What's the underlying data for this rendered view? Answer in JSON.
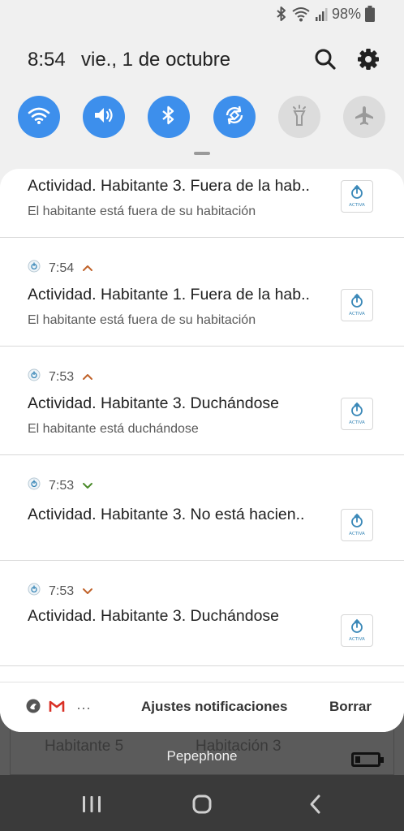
{
  "status_bar": {
    "battery": "98%"
  },
  "header": {
    "time": "8:54",
    "date": "vie., 1 de octubre"
  },
  "quick_settings": [
    {
      "name": "wifi",
      "on": true
    },
    {
      "name": "sound",
      "on": true
    },
    {
      "name": "bluetooth",
      "on": true
    },
    {
      "name": "auto-rotate",
      "on": true
    },
    {
      "name": "flashlight",
      "on": false
    },
    {
      "name": "airplane",
      "on": false
    }
  ],
  "notifications": [
    {
      "title": "Actividad. Habitante 3. Fuera de la hab..",
      "text": "El habitante está fuera de su habitación",
      "time": ""
    },
    {
      "title": "Actividad. Habitante 1. Fuera de la hab..",
      "text": "El habitante está fuera de su habitación",
      "time": "7:54",
      "chevron": "up"
    },
    {
      "title": "Actividad. Habitante 3. Duchándose",
      "text": "El habitante está duchándose",
      "time": "7:53",
      "chevron": "up"
    },
    {
      "title": "Actividad. Habitante 3. No está hacien..",
      "text": "",
      "time": "7:53",
      "chevron": "down"
    },
    {
      "title": "Actividad. Habitante 3. Duchándose",
      "text": "",
      "time": "7:53",
      "chevron": "down"
    }
  ],
  "app_thumb_label": "ACTIVA",
  "footer": {
    "settings_label": "Ajustes notificaciones",
    "clear_label": "Borrar",
    "more": "···"
  },
  "background_app": {
    "cell_1": "Habitante 5",
    "cell_2": "Habitación 3"
  },
  "carrier": "Pepephone",
  "colors": {
    "accent": "#3d8fec",
    "chevron_up": "#c0622a",
    "chevron_down": "#4a8a2a",
    "gmail_red": "#d93025"
  }
}
